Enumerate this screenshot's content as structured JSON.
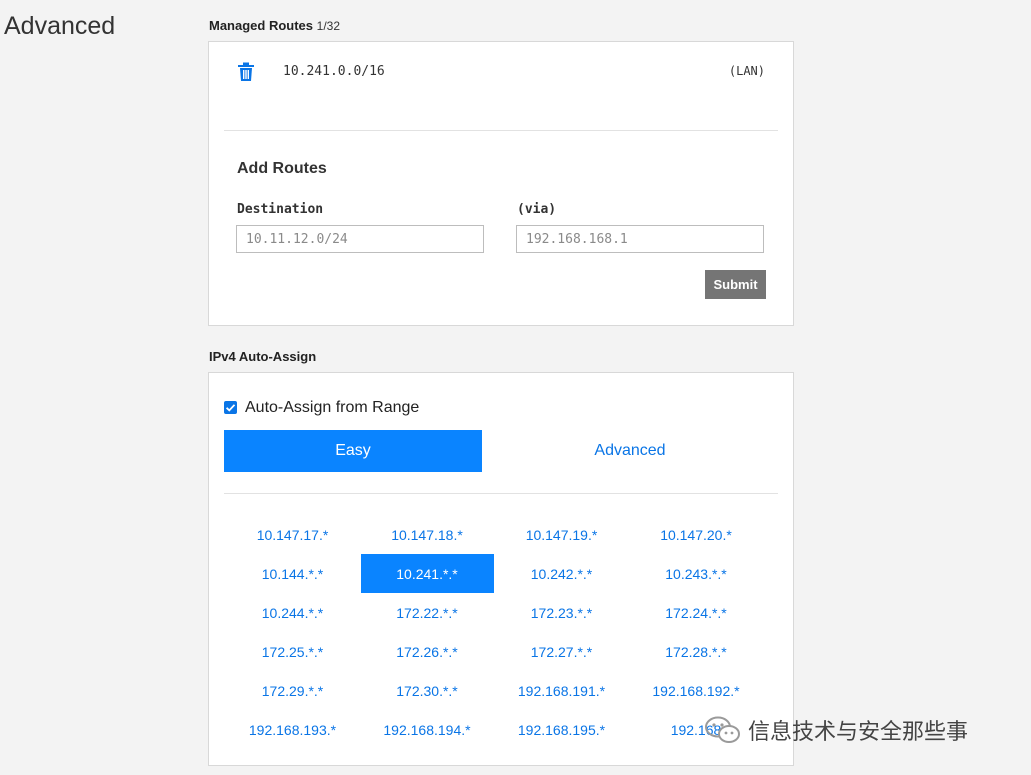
{
  "page": {
    "section_title": "Advanced"
  },
  "managed_routes": {
    "title": "Managed Routes",
    "count": "1/32",
    "routes": [
      {
        "destination": "10.241.0.0/16",
        "via": "(LAN)"
      }
    ],
    "add": {
      "title": "Add Routes",
      "destination_label": "Destination",
      "destination_placeholder": "10.11.12.0/24",
      "via_label": "(via)",
      "via_placeholder": "192.168.168.1",
      "submit_label": "Submit"
    }
  },
  "ipv4": {
    "title": "IPv4 Auto-Assign",
    "checkbox_label": "Auto-Assign from Range",
    "checked": true,
    "tabs": [
      {
        "label": "Easy",
        "active": true
      },
      {
        "label": "Advanced",
        "active": false
      }
    ],
    "selected": "10.241.*.*",
    "ranges": [
      "10.147.17.*",
      "10.147.18.*",
      "10.147.19.*",
      "10.147.20.*",
      "10.144.*.*",
      "10.241.*.*",
      "10.242.*.*",
      "10.243.*.*",
      "10.244.*.*",
      "172.22.*.*",
      "172.23.*.*",
      "172.24.*.*",
      "172.25.*.*",
      "172.26.*.*",
      "172.27.*.*",
      "172.28.*.*",
      "172.29.*.*",
      "172.30.*.*",
      "192.168.191.*",
      "192.168.192.*",
      "192.168.193.*",
      "192.168.194.*",
      "192.168.195.*",
      "192.168"
    ]
  },
  "watermark": {
    "text": "信息技术与安全那些事"
  },
  "colors": {
    "accent": "#0a84ff",
    "link": "#0a75e6",
    "submit_bg": "#757575"
  }
}
